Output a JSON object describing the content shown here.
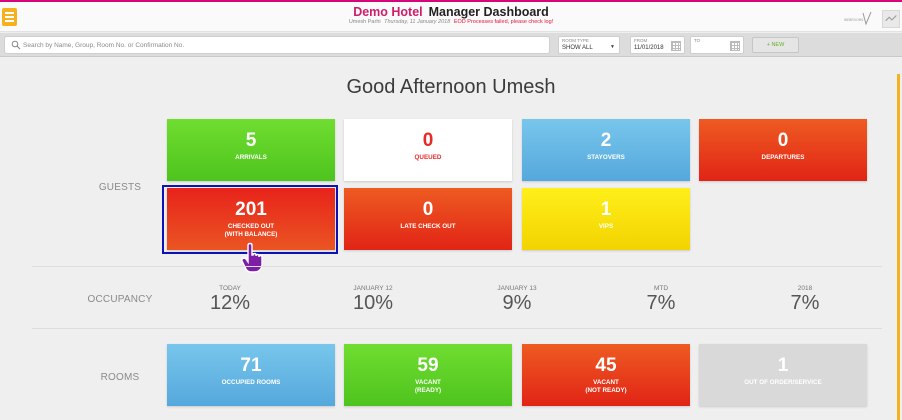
{
  "header": {
    "hotel_name": "Demo Hotel",
    "dashboard_title": "Manager Dashboard",
    "user_name": "Umesh Parhi",
    "date_text": "Thursday, 11 January 2018",
    "alert_text": "EOD Processes failed, please check log!",
    "logo_text": "WEBROOMS"
  },
  "toolbar": {
    "search_placeholder": "Search by Name, Group, Room No. or Confirmation No.",
    "room_type_label": "ROOM TYPE",
    "room_type_value": "SHOW ALL",
    "from_label": "FROM",
    "from_value": "11/01/2018",
    "to_label": "TO",
    "to_value": "",
    "new_label": "+ NEW"
  },
  "greeting": "Good Afternoon Umesh",
  "sections": {
    "guests": "GUESTS",
    "occupancy": "OCCUPANCY",
    "rooms": "ROOMS"
  },
  "guests": [
    {
      "value": "5",
      "label": "ARRIVALS",
      "color": "#5fd026"
    },
    {
      "value": "0",
      "label": "QUEUED",
      "color": "#ffffff"
    },
    {
      "value": "2",
      "label": "STAYOVERS",
      "color": "#66b6e6"
    },
    {
      "value": "0",
      "label": "DEPARTURES",
      "color": "#e8371c"
    },
    {
      "value": "201",
      "label": "CHECKED OUT",
      "label2": "(WITH BALANCE)",
      "color": "#e8231b"
    },
    {
      "value": "0",
      "label": "LATE CHECK OUT",
      "color": "#e8371c"
    },
    {
      "value": "1",
      "label": "VIPS",
      "color": "#f8e10a"
    }
  ],
  "occupancy": [
    {
      "period": "TODAY",
      "value": "12%"
    },
    {
      "period": "JANUARY 12",
      "value": "10%"
    },
    {
      "period": "JANUARY 13",
      "value": "9%"
    },
    {
      "period": "MTD",
      "value": "7%"
    },
    {
      "period": "2018",
      "value": "7%"
    }
  ],
  "rooms": [
    {
      "value": "71",
      "label": "OCCUPIED ROOMS",
      "color": "#66b6e6"
    },
    {
      "value": "59",
      "label": "VACANT",
      "label2": "(READY)",
      "color": "#5fd026"
    },
    {
      "value": "45",
      "label": "VACANT",
      "label2": "(NOT READY)",
      "color": "#e8371c"
    },
    {
      "value": "1",
      "label": "OUT OF ORDER/SERVICE",
      "color": "#d9d9d9"
    }
  ],
  "colors": {
    "accent_pink": "#d6067a",
    "menu_yellow": "#f5b21d",
    "selection_blue": "#0c12b5"
  }
}
